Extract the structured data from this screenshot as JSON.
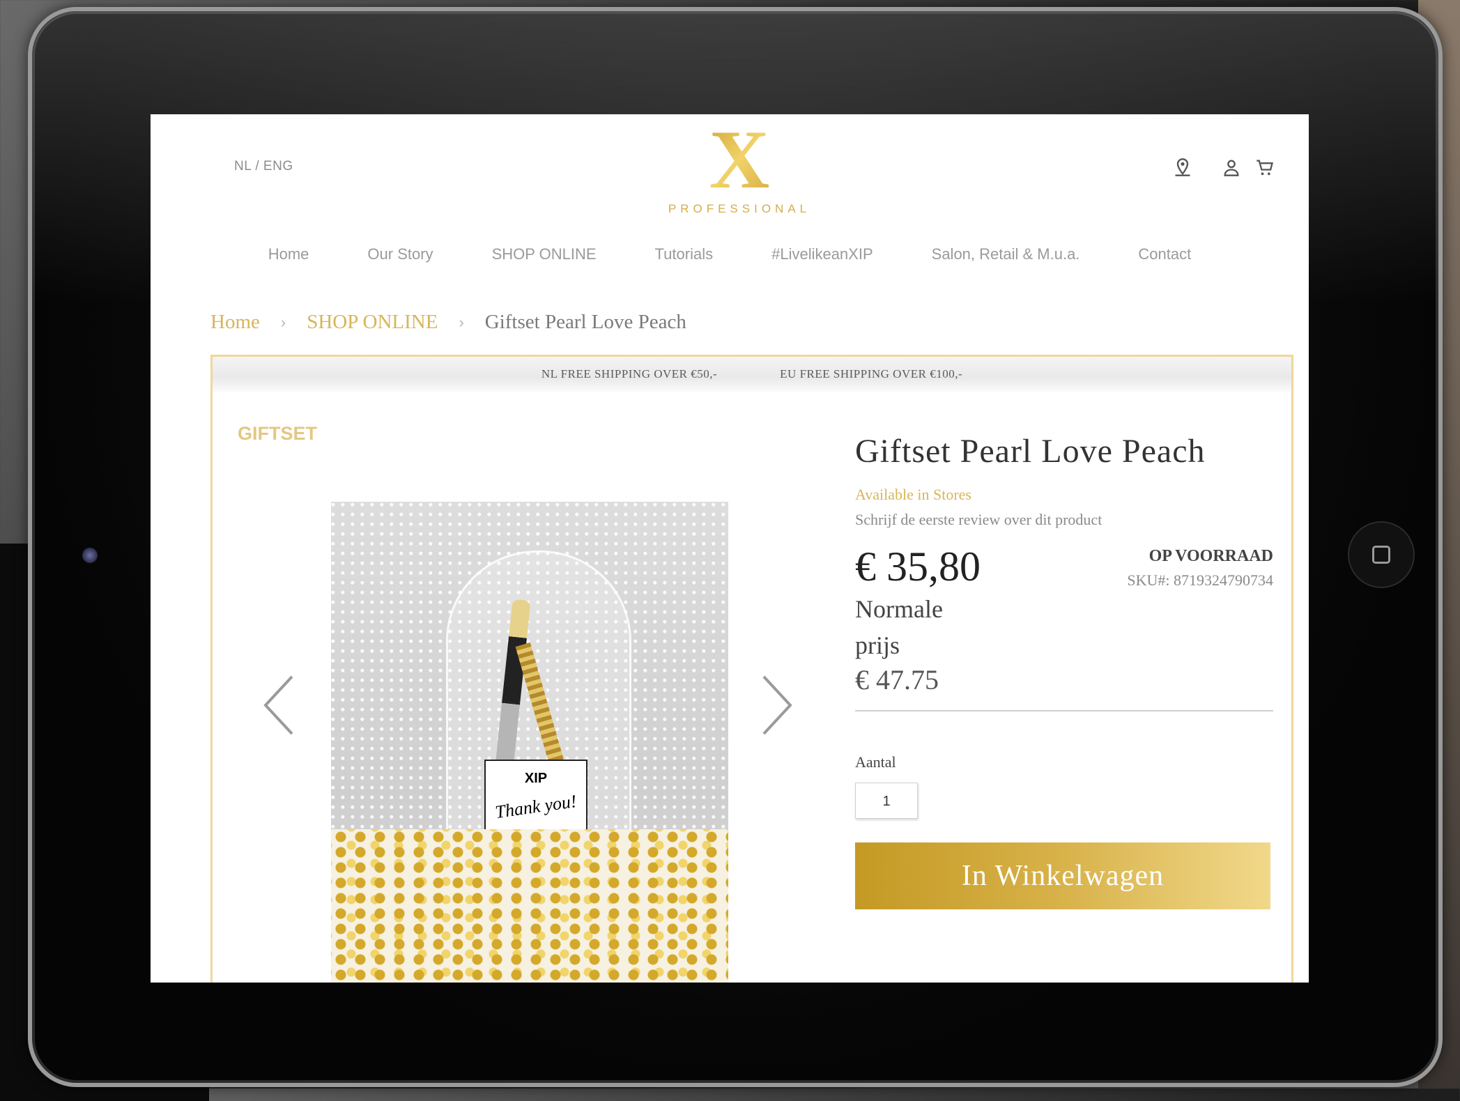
{
  "header": {
    "language_switch": "NL / ENG",
    "logo_letter": "X",
    "logo_subtitle": "PROFESSIONAL",
    "icons": [
      "store-locator-icon",
      "account-icon",
      "cart-icon"
    ]
  },
  "nav": {
    "items": [
      {
        "label": "Home"
      },
      {
        "label": "Our Story"
      },
      {
        "label": "SHOP ONLINE"
      },
      {
        "label": "Tutorials"
      },
      {
        "label": "#LivelikeanXIP"
      },
      {
        "label": "Salon, Retail & M.u.a."
      },
      {
        "label": "Contact"
      }
    ]
  },
  "breadcrumb": {
    "items": [
      "Home",
      "SHOP ONLINE",
      "Giftset Pearl Love Peach"
    ],
    "separator": "›"
  },
  "shipping_bar": {
    "nl": "NL FREE SHIPPING OVER €50,-",
    "eu": "EU FREE SHIPPING OVER €100,-"
  },
  "product": {
    "category": "GIFTSET",
    "title": "Giftset Pearl Love Peach",
    "availability": "Available in Stores",
    "review_link": "Schrijf de eerste review over dit product",
    "price": "€ 35,80",
    "normal_price_label": "Normale prijs",
    "normal_price": "€ 47.75",
    "stock_status": "OP VOORRAAD",
    "sku": "SKU#: 8719324790734",
    "quantity_label": "Aantal",
    "quantity_value": "1",
    "add_to_cart": "In Winkelwagen",
    "image_card_brand": "XIP",
    "image_card_text": "Thank you!"
  },
  "colors": {
    "gold_accent": "#d7b658",
    "panel_border": "#f0d79a",
    "button_gold_start": "#c49a24",
    "button_gold_end": "#f1d88a"
  }
}
